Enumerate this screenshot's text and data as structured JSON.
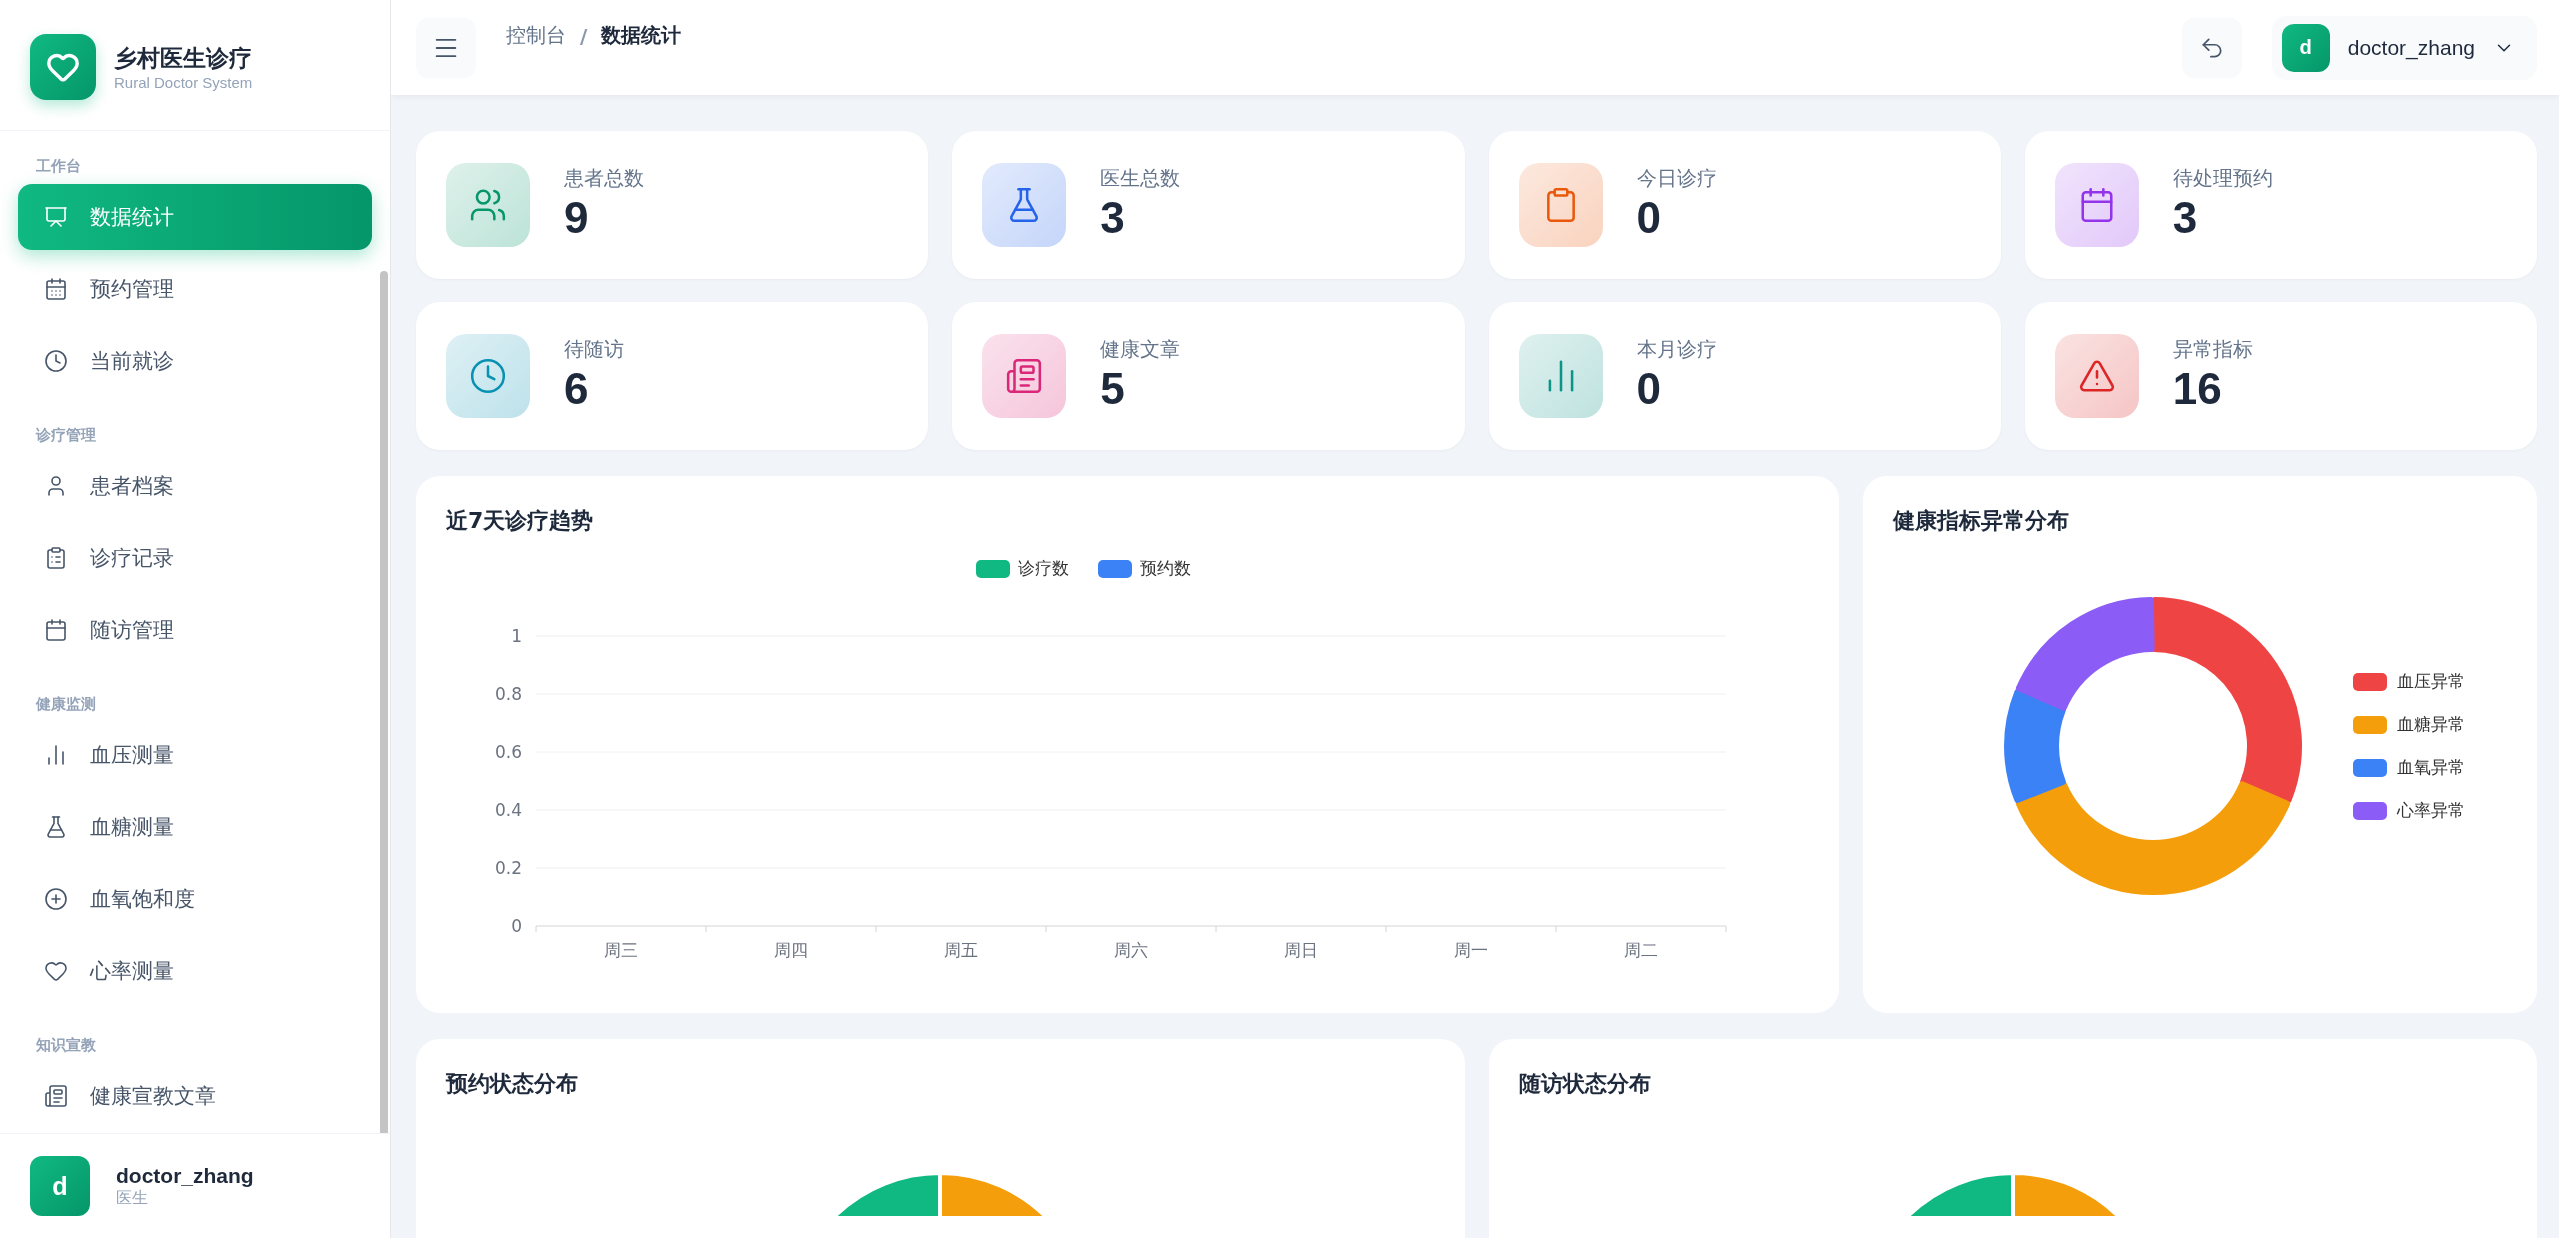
{
  "brand": {
    "title": "乡村医生诊疗",
    "subtitle": "Rural Doctor System"
  },
  "sidebar": {
    "sections": [
      {
        "label": "工作台",
        "items": [
          {
            "label": "数据统计",
            "selected": true
          },
          {
            "label": "预约管理",
            "selected": false
          },
          {
            "label": "当前就诊",
            "selected": false
          }
        ]
      },
      {
        "label": "诊疗管理",
        "items": [
          {
            "label": "患者档案",
            "selected": false
          },
          {
            "label": "诊疗记录",
            "selected": false
          },
          {
            "label": "随访管理",
            "selected": false
          }
        ]
      },
      {
        "label": "健康监测",
        "items": [
          {
            "label": "血压测量",
            "selected": false
          },
          {
            "label": "血糖测量",
            "selected": false
          },
          {
            "label": "血氧饱和度",
            "selected": false
          },
          {
            "label": "心率测量",
            "selected": false
          }
        ]
      },
      {
        "label": "知识宣教",
        "items": [
          {
            "label": "健康宣教文章",
            "selected": false
          }
        ]
      }
    ]
  },
  "sidebar_user": {
    "avatar": "d",
    "name": "doctor_zhang",
    "role": "医生"
  },
  "breadcrumb": {
    "items": [
      "控制台",
      "数据统计"
    ],
    "separator": "/"
  },
  "header_user": {
    "avatar": "d",
    "name": "doctor_zhang"
  },
  "stats": [
    {
      "label": "患者总数",
      "value": "9",
      "color": "#059669"
    },
    {
      "label": "医生总数",
      "value": "3",
      "color": "#2563eb"
    },
    {
      "label": "今日诊疗",
      "value": "0",
      "color": "#ea580c"
    },
    {
      "label": "待处理预约",
      "value": "3",
      "color": "#9333ea"
    },
    {
      "label": "待随访",
      "value": "6",
      "color": "#0891b2"
    },
    {
      "label": "健康文章",
      "value": "5",
      "color": "#db2777"
    },
    {
      "label": "本月诊疗",
      "value": "0",
      "color": "#0d9488"
    },
    {
      "label": "异常指标",
      "value": "16",
      "color": "#dc2626"
    }
  ],
  "trend_card": {
    "title": "近7天诊疗趋势",
    "chart_data": {
      "type": "line",
      "categories": [
        "周三",
        "周四",
        "周五",
        "周六",
        "周日",
        "周一",
        "周二"
      ],
      "series": [
        {
          "name": "诊疗数",
          "color": "#10b981",
          "values": [
            null,
            null,
            null,
            null,
            null,
            null,
            null
          ]
        },
        {
          "name": "预约数",
          "color": "#3b82f6",
          "values": [
            null,
            null,
            null,
            null,
            null,
            null,
            null
          ]
        }
      ],
      "grid": true,
      "ylim": [
        0,
        1
      ],
      "yticks": [
        {
          "value": 0,
          "label": "0"
        },
        {
          "value": 0.2,
          "label": "0.2"
        },
        {
          "value": 0.4,
          "label": "0.4"
        },
        {
          "value": 0.6,
          "label": "0.6"
        },
        {
          "value": 0.8,
          "label": "0.8"
        },
        {
          "value": 1,
          "label": "1"
        }
      ]
    }
  },
  "abnormal_card": {
    "title": "健康指标异常分布",
    "legend": [
      {
        "label": "血压异常",
        "color": "#ef4444"
      },
      {
        "label": "血糖异常",
        "color": "#f59e0b"
      },
      {
        "label": "血氧异常",
        "color": "#3b82f6"
      },
      {
        "label": "心率异常",
        "color": "#8b5cf6"
      }
    ]
  },
  "appointment_card": {
    "title": "预约状态分布"
  },
  "followup_card": {
    "title": "随访状态分布"
  }
}
